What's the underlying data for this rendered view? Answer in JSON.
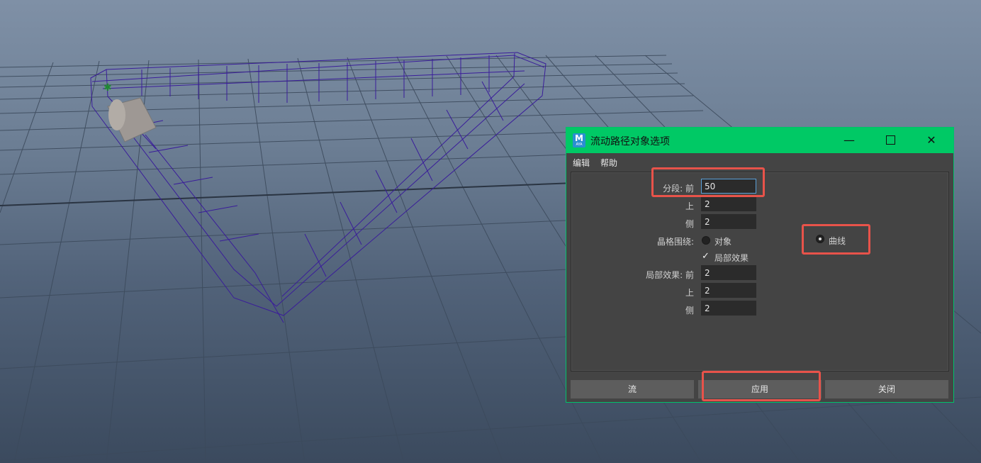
{
  "dialog": {
    "title": "流动路径对象选项",
    "window_buttons": {
      "minimize": "—",
      "close": "✕"
    },
    "menu": [
      "编辑",
      "帮助"
    ],
    "app_icon": {
      "letter": "M",
      "sub": "AYA"
    },
    "fields": {
      "segments_label": "分段: 前",
      "segments_front": "50",
      "up_label": "上",
      "segments_up": "2",
      "side_label": "侧",
      "segments_side": "2",
      "lattice_label": "晶格围绕:",
      "option_object": "对象",
      "option_curve": "曲线",
      "local_effect_checkbox": "局部效果",
      "local_label": "局部效果: 前",
      "local_front": "2",
      "local_up_label": "上",
      "local_up": "2",
      "local_side_label": "侧",
      "local_side": "2"
    },
    "selected_lattice_option": "曲线",
    "local_effect_checked": true,
    "buttons": {
      "flow": "流",
      "apply": "应用",
      "close": "关闭"
    }
  },
  "colors": {
    "titlebar": "#00c965",
    "highlight": "#e8534a",
    "wireframe": "#2a1a8c"
  }
}
